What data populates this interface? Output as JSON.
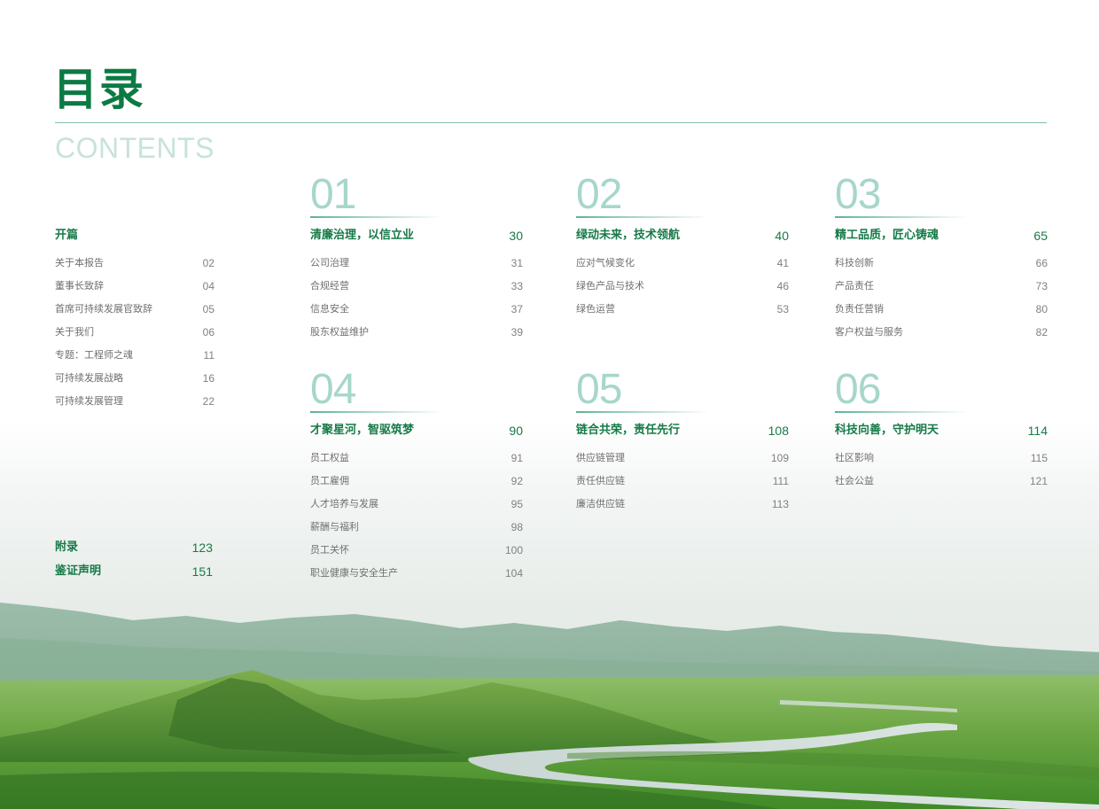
{
  "title": "目录",
  "subtitle": "CONTENTS",
  "intro": {
    "heading": "开篇",
    "items": [
      {
        "label": "关于本报告",
        "page": "02"
      },
      {
        "label": "董事长致辞",
        "page": "04"
      },
      {
        "label": "首席可持续发展官致辞",
        "page": "05"
      },
      {
        "label": "关于我们",
        "page": "06"
      },
      {
        "label": "专题：工程师之魂",
        "page": "11"
      },
      {
        "label": "可持续发展战略",
        "page": "16"
      },
      {
        "label": "可持续发展管理",
        "page": "22"
      }
    ]
  },
  "extras": [
    {
      "label": "附录",
      "page": "123"
    },
    {
      "label": "鉴证声明",
      "page": "151"
    }
  ],
  "chapters": [
    {
      "number": "01",
      "heading": "清廉治理，以信立业",
      "page": "30",
      "items": [
        {
          "label": "公司治理",
          "page": "31"
        },
        {
          "label": "合规经营",
          "page": "33"
        },
        {
          "label": "信息安全",
          "page": "37"
        },
        {
          "label": "股东权益维护",
          "page": "39"
        }
      ]
    },
    {
      "number": "02",
      "heading": "绿动未来，技术领航",
      "page": "40",
      "items": [
        {
          "label": "应对气候变化",
          "page": "41"
        },
        {
          "label": "绿色产品与技术",
          "page": "46"
        },
        {
          "label": "绿色运营",
          "page": "53"
        }
      ]
    },
    {
      "number": "03",
      "heading": "精工品质，匠心铸魂",
      "page": "65",
      "items": [
        {
          "label": "科技创新",
          "page": "66"
        },
        {
          "label": "产品责任",
          "page": "73"
        },
        {
          "label": "负责任营销",
          "page": "80"
        },
        {
          "label": "客户权益与服务",
          "page": "82"
        }
      ]
    },
    {
      "number": "04",
      "heading": "才聚星河，智驱筑梦",
      "page": "90",
      "items": [
        {
          "label": "员工权益",
          "page": "91"
        },
        {
          "label": "员工雇佣",
          "page": "92"
        },
        {
          "label": "人才培养与发展",
          "page": "95"
        },
        {
          "label": "薪酬与福利",
          "page": "98"
        },
        {
          "label": "员工关怀",
          "page": "100"
        },
        {
          "label": "职业健康与安全生产",
          "page": "104"
        }
      ]
    },
    {
      "number": "05",
      "heading": "链合共荣，责任先行",
      "page": "108",
      "items": [
        {
          "label": "供应链管理",
          "page": "109"
        },
        {
          "label": "责任供应链",
          "page": "111"
        },
        {
          "label": "廉洁供应链",
          "page": "113"
        }
      ]
    },
    {
      "number": "06",
      "heading": "科技向善，守护明天",
      "page": "114",
      "items": [
        {
          "label": "社区影响",
          "page": "115"
        },
        {
          "label": "社会公益",
          "page": "121"
        }
      ]
    }
  ],
  "colors": {
    "title_green": "#0b7a43",
    "heading_green": "#167a48",
    "number_teal": "#a7d6cb",
    "subtitle_mint": "#c7e3db",
    "body_gray": "#6f6f6f"
  },
  "icons": {
    "background": "grassland-river-landscape"
  }
}
